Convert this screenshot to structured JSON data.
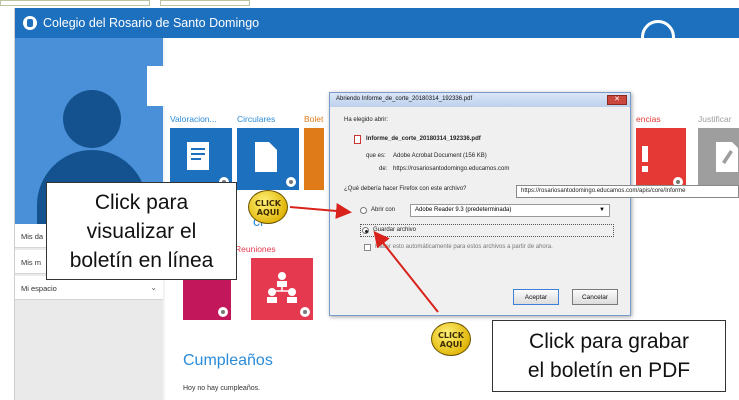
{
  "app": {
    "title": "Colegio del Rosario de Santo Domingo"
  },
  "sidebar": {
    "items": [
      {
        "label": "Mis da"
      },
      {
        "label": "Mis m"
      },
      {
        "label": "Mi espacio"
      }
    ]
  },
  "tiles_row1": [
    {
      "label": "Valoracion...",
      "color": "#1d70bd",
      "icon": "report-icon"
    },
    {
      "label": "Circulares",
      "color": "#1d70bd",
      "icon": "document-icon"
    },
    {
      "label": "Bolet",
      "color": "#e07b1a",
      "icon": "bulletin-icon"
    },
    {
      "label": "encias",
      "color": "#e53935",
      "icon": "alert-icon"
    },
    {
      "label": "Justificar",
      "color": "#9e9e9e",
      "icon": "justify-icon"
    }
  ],
  "section_partial": "ci",
  "tiles_row2": [
    {
      "label": "",
      "color": "#c2185b",
      "icon": "people-icon"
    },
    {
      "label": "Reuniones",
      "color": "#e53950",
      "icon": "meeting-icon"
    }
  ],
  "birthdays": {
    "title": "Cumpleaños",
    "empty_text": "Hoy no hay cumpleaños."
  },
  "dialog": {
    "title": "Abriendo Informe_de_corte_20180314_192336.pdf",
    "chosen_label": "Ha elegido abrir:",
    "filename": "Informe_de_corte_20180314_192336.pdf",
    "type_label": "que es:",
    "type_value": "Adobe Acrobat Document (156 KB)",
    "from_label": "de:",
    "from_value": "https://rosariosantodomingo.educamos.com",
    "question": "¿Qué debería hacer Firefox con este archivo?",
    "open_with_label": "Abrir con",
    "open_with_value": "Adobe Reader 9.3 (predeterminada)",
    "save_label": "Guardar archivo",
    "auto_label": "Hacer esto automáticamente para estos archivos a partir de ahora.",
    "accept": "Aceptar",
    "cancel": "Cancelar"
  },
  "tooltip": "https://rosariosantodomingo.educamos.com/apis/core/Informe",
  "callouts": {
    "view": [
      "Click para",
      "visualizar el",
      "boletín en línea"
    ],
    "save": [
      "Click para grabar",
      "el boletín en PDF"
    ]
  },
  "stamps": [
    "CLICK",
    "AQUI"
  ],
  "colors": {
    "brand_blue": "#1d70bd",
    "arrow_red": "#d9221c"
  }
}
